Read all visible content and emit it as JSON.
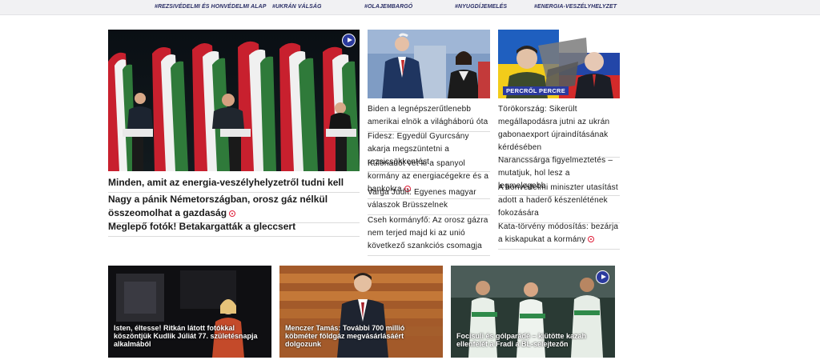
{
  "tags": [
    {
      "label": "#REZSIVÉDELMI ÉS HONVÉDELMI ALAP"
    },
    {
      "label": "#UKRÁN VÁLSÁG"
    },
    {
      "label": "#OLAJEMBARGÓ"
    },
    {
      "label": "#NYUGDÍJEMELÉS"
    },
    {
      "label": "#ENERGIA-VESZÉLYHELYZET"
    }
  ],
  "main_column": {
    "headlines": [
      "Minden, amit az energia-veszélyhelyzetről tudni kell",
      "Nagy a pánik Németországban, orosz gáz nélkül összeomolhat a gazdaság",
      "Meglepő fotók! Betakargatták a gleccsert"
    ]
  },
  "middle_column": {
    "headlines": [
      "Biden a legnépszerűtlenebb amerikai elnök a világháború óta",
      "Fidesz: Egyedül Gyurcsány akarja megszüntetni a rezsicsökkentést",
      "Különadót vet ki a spanyol kormány az energiacégekre és a bankokra",
      "Varga Judit: Egyenes magyar válaszok Brüsszelnek",
      "Cseh kormányfő: Az orosz gázra nem terjed majd ki az unió következő szankciós csomagja"
    ]
  },
  "right_column": {
    "badge": "PERCRŐL PERCRE",
    "headlines": [
      "Törökország: Sikerült megállapodásra jutni az ukrán gabonaexport újraindításának kérdésében",
      "Narancssárga figyelmeztetés – mutatjuk, hol lesz a legmelegebb",
      "A honvédelmi miniszter utasítást adott a haderő készenlétének fokozására",
      "Kata-törvény módosítás: bezárja a kiskapukat a kormány"
    ]
  },
  "bottom_cards": [
    {
      "caption": "Isten, éltesse! Ritkán látott fotókkal köszöntjük Kudlik Júliát 77. születésnapja alkalmából"
    },
    {
      "caption": "Menczer Tamás: További 700 millió köbméter földgáz megvásárlásáért dolgozunk"
    },
    {
      "caption": "Focisuli és gólparádé – kiütötte kazah ellenfelét a Fradi a BL-selejtezőn"
    }
  ],
  "colors": {
    "accent": "#2b3a9e",
    "record_red": "#e0203a",
    "tag_text": "#2b2f66"
  }
}
